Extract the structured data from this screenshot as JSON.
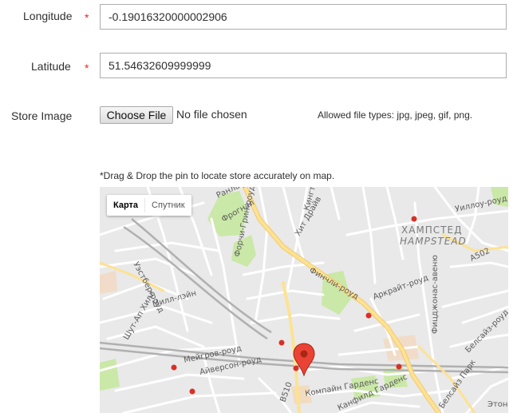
{
  "form": {
    "longitude": {
      "label": "Longitude",
      "required_mark": "*",
      "value": "-0.19016320000002906"
    },
    "latitude": {
      "label": "Latitude",
      "required_mark": "*",
      "value": "51.54632609999999"
    },
    "store_image": {
      "label": "Store Image",
      "button_label": "Choose File",
      "status": "No file chosen",
      "allowed_types": "Allowed file types: jpg, jpeg, gif, png."
    }
  },
  "map": {
    "hint": "*Drag & Drop the pin to locate store accurately on map.",
    "type_control": {
      "map_label": "Карта",
      "satellite_label": "Спутник",
      "selected": "map"
    },
    "district_label_ru": "ХАМПСТЕД",
    "district_label_en": "HAMPSTEAD",
    "street_labels": {
      "finchley_road": "Финчли-роуд",
      "fitzjohns": "Фицджонас-авеню",
      "arkwright": "Аркрайт-роуд",
      "willoughby": "Уиллоу-роуд",
      "a502": "A502",
      "hit_drive": "Хит Драйв",
      "ranelagh": "Ранлаф-роуд",
      "frognal": "Фрогнал",
      "forchy_green": "Форчи-Грин-роуд",
      "uestber": "Уэстбер-роуд",
      "mill_lane": "Милл-лэйн",
      "shoot_up_hill": "Шут-Ап Хилл",
      "maygrove": "Мейгров-роуд",
      "ayverson": "Айверсон-роуд",
      "b510": "B510",
      "compayne": "Компайн Гарденс",
      "canfield": "Канфилд Гарденс",
      "belsize_park": "Белсайз Парк",
      "belsize_road": "Белсайз-роуд",
      "eton": "Этон-",
      "kington": "Кингтон-роуд"
    },
    "pin_icon": "map-marker-icon"
  }
}
